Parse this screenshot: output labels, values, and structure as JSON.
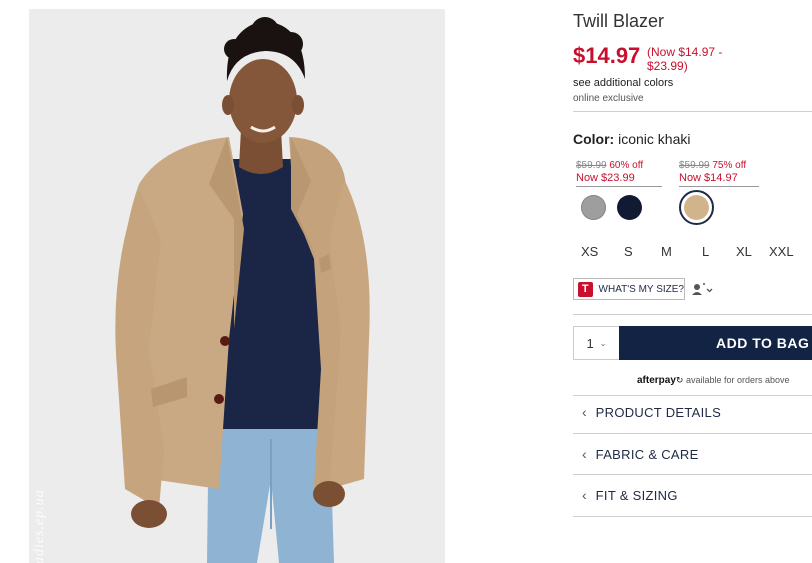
{
  "product": {
    "title": "Twill Blazer",
    "price": "$14.97",
    "price_range": "(Now $14.97 - $23.99)",
    "see_colors": "see additional colors",
    "online_exclusive": "online exclusive"
  },
  "color": {
    "label": "Color:",
    "value": "iconic khaki",
    "groups": [
      {
        "was": "$59.99",
        "pct": "60% off",
        "now": "Now $23.99"
      },
      {
        "was": "$59.99",
        "pct": "75% off",
        "now": "Now $14.97"
      }
    ],
    "swatches": [
      {
        "name": "heather grey",
        "hex": "#9e9e9e"
      },
      {
        "name": "navy",
        "hex": "#101a33"
      },
      {
        "name": "iconic khaki",
        "hex": "#d2b48c",
        "selected": true
      }
    ]
  },
  "sizes": [
    "XS",
    "S",
    "M",
    "L",
    "XL",
    "XXL"
  ],
  "size_finder": {
    "logo": "T",
    "label": "WHAT'S MY SIZE?"
  },
  "cart": {
    "quantity": "1",
    "add_label": "ADD TO BAG"
  },
  "afterpay": {
    "logo": "afterpay",
    "text": "available for orders above"
  },
  "accordions": [
    "PRODUCT DETAILS",
    "FABRIC & CARE",
    "FIT & SIZING"
  ],
  "watermark": "ladies.ep.ua",
  "colors": {
    "sale_red": "#c8102e",
    "navy_button": "#122344",
    "text_navy": "#1f2a44"
  }
}
